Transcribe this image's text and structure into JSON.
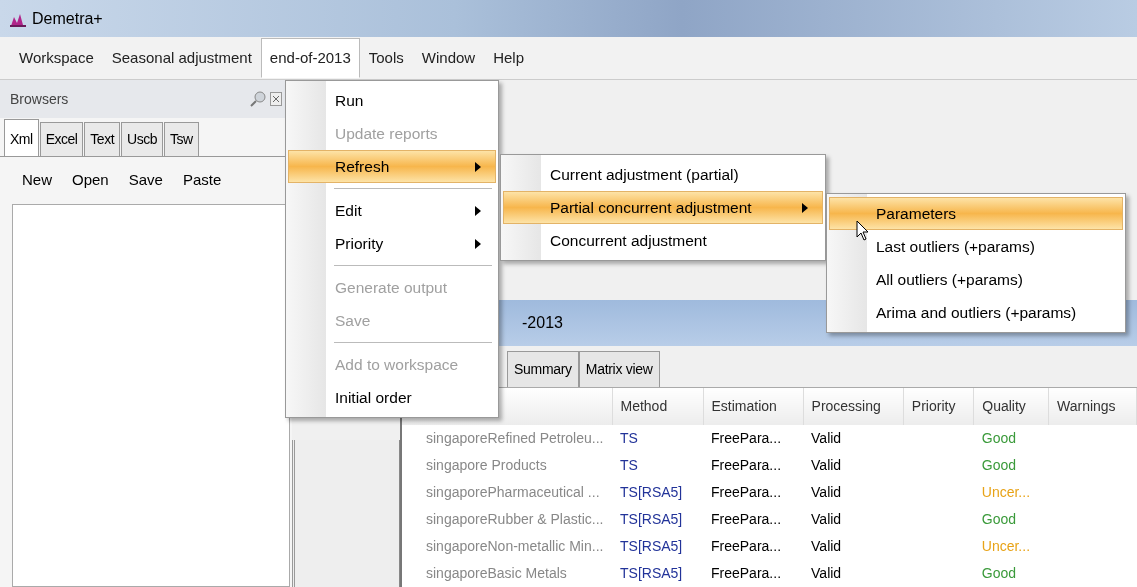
{
  "window": {
    "title": "Demetra+"
  },
  "menubar": [
    {
      "label": "Workspace",
      "selected": false
    },
    {
      "label": "Seasonal adjustment",
      "selected": false
    },
    {
      "label": "end-of-2013",
      "selected": true
    },
    {
      "label": "Tools",
      "selected": false
    },
    {
      "label": "Window",
      "selected": false
    },
    {
      "label": "Help",
      "selected": false
    }
  ],
  "browsers": {
    "title": "Browsers",
    "tabs": [
      {
        "label": "Xml",
        "selected": true
      },
      {
        "label": "Excel",
        "selected": false
      },
      {
        "label": "Text",
        "selected": false
      },
      {
        "label": "Uscb",
        "selected": false
      },
      {
        "label": "Tsw",
        "selected": false
      }
    ],
    "toolbar": [
      "New",
      "Open",
      "Save",
      "Paste"
    ]
  },
  "document": {
    "title": "-2013",
    "tabs": [
      {
        "label": "Summary",
        "selected": false
      },
      {
        "label": "Matrix view",
        "selected": false
      }
    ],
    "columns": [
      "Method",
      "Estimation",
      "Processing",
      "Priority",
      "Quality",
      "Warnings"
    ],
    "rows": [
      {
        "series": "singaporeRefined Petroleu...",
        "method": "TS",
        "estimation": "FreePara...",
        "processing": "Valid",
        "quality": "Good",
        "color": "#3a9a3a"
      },
      {
        "series": "singapore Products",
        "method": "TS",
        "estimation": "FreePara...",
        "processing": "Valid",
        "quality": "Good",
        "color": "#3a9a3a"
      },
      {
        "series": "singaporePharmaceutical ...",
        "method": "TS[RSA5]",
        "estimation": "FreePara...",
        "processing": "Valid",
        "quality": "Uncer...",
        "color": "#e8a317"
      },
      {
        "series": "singaporeRubber & Plastic...",
        "method": "TS[RSA5]",
        "estimation": "FreePara...",
        "processing": "Valid",
        "quality": "Good",
        "color": "#3a9a3a"
      },
      {
        "series": "singaporeNon-metallic Min...",
        "method": "TS[RSA5]",
        "estimation": "FreePara...",
        "processing": "Valid",
        "quality": "Uncer...",
        "color": "#e8a317"
      },
      {
        "series": "singaporeBasic Metals",
        "method": "TS[RSA5]",
        "estimation": "FreePara...",
        "processing": "Valid",
        "quality": "Good",
        "color": "#3a9a3a"
      }
    ]
  },
  "menu": [
    {
      "kind": "item",
      "label": "Run",
      "disabled": false,
      "has_submenu": false,
      "selected": false
    },
    {
      "kind": "item",
      "label": "Update reports",
      "disabled": true,
      "has_submenu": false,
      "selected": false
    },
    {
      "kind": "item",
      "label": "Refresh",
      "disabled": false,
      "has_submenu": true,
      "selected": true
    },
    {
      "kind": "separator"
    },
    {
      "kind": "item",
      "label": "Edit",
      "disabled": false,
      "has_submenu": true,
      "selected": false
    },
    {
      "kind": "item",
      "label": "Priority",
      "disabled": false,
      "has_submenu": true,
      "selected": false
    },
    {
      "kind": "separator"
    },
    {
      "kind": "item",
      "label": "Generate output",
      "disabled": true,
      "has_submenu": false,
      "selected": false
    },
    {
      "kind": "item",
      "label": "Save",
      "disabled": true,
      "has_submenu": false,
      "selected": false
    },
    {
      "kind": "separator"
    },
    {
      "kind": "item",
      "label": "Add to workspace",
      "disabled": true,
      "has_submenu": false,
      "selected": false
    },
    {
      "kind": "item",
      "label": "Initial order",
      "disabled": false,
      "has_submenu": false,
      "selected": false
    }
  ],
  "refresh_submenu": [
    {
      "kind": "item",
      "label": "Current adjustment (partial)",
      "disabled": false,
      "has_submenu": false,
      "selected": false
    },
    {
      "kind": "item",
      "label": "Partial concurrent adjustment",
      "disabled": false,
      "has_submenu": true,
      "selected": true
    },
    {
      "kind": "item",
      "label": "Concurrent adjustment",
      "disabled": false,
      "has_submenu": false,
      "selected": false
    }
  ],
  "partial_submenu": [
    {
      "kind": "item",
      "label": "Parameters",
      "disabled": false,
      "has_submenu": false,
      "selected": true
    },
    {
      "kind": "item",
      "label": "Last outliers (+params)",
      "disabled": false,
      "has_submenu": false,
      "selected": false
    },
    {
      "kind": "item",
      "label": "All outliers (+params)",
      "disabled": false,
      "has_submenu": false,
      "selected": false
    },
    {
      "kind": "item",
      "label": "Arima and outliers (+params)",
      "disabled": false,
      "has_submenu": false,
      "selected": false
    }
  ]
}
